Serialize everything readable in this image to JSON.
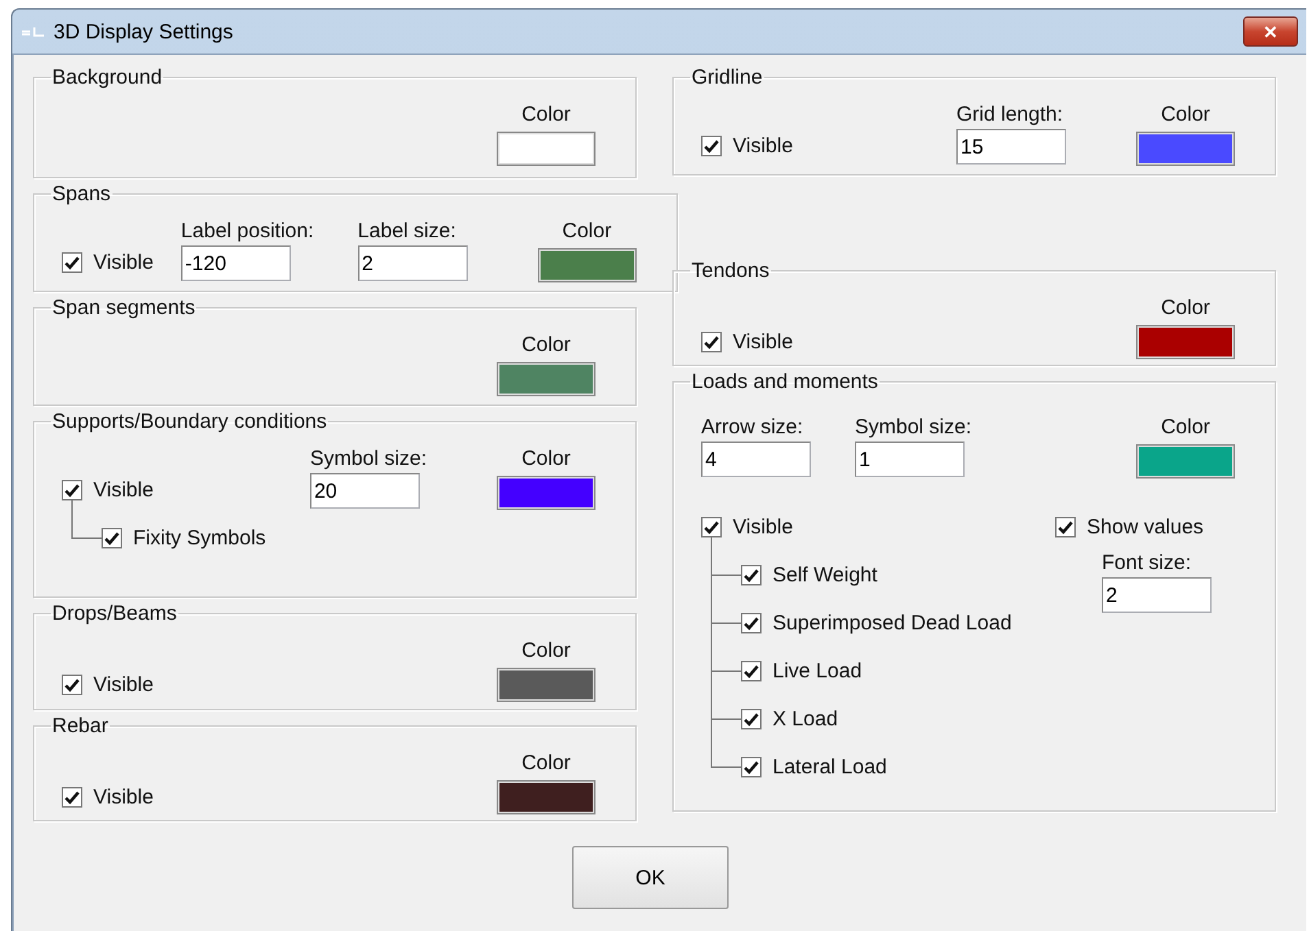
{
  "window": {
    "title": "3D Display Settings",
    "close": "✕"
  },
  "left_groups": [
    {
      "title": "Background",
      "color": {
        "label": "Color",
        "color": "#ffffff"
      }
    },
    {
      "title": "Spans",
      "visible": {
        "label": "Visible",
        "checked": true
      },
      "fields": [
        {
          "label": "Label position:",
          "value": "-120"
        },
        {
          "label": "Label size:",
          "value": "2"
        }
      ],
      "color": {
        "label": "Color",
        "color": "#4b7f4b"
      }
    },
    {
      "title": "Span segments",
      "color": {
        "label": "Color",
        "color": "#4f8462"
      }
    },
    {
      "title": "Supports/Boundary conditions",
      "visible": {
        "label": "Visible",
        "checked": true,
        "children": [
          {
            "label": "Fixity Symbols",
            "checked": true
          }
        ]
      },
      "fields": [
        {
          "label": "Symbol size:",
          "value": "20"
        }
      ],
      "color": {
        "label": "Color",
        "color": "#4400ff"
      }
    },
    {
      "title": "Drops/Beams",
      "visible": {
        "label": "Visible",
        "checked": true
      },
      "color": {
        "label": "Color",
        "color": "#5a5a5a"
      }
    },
    {
      "title": "Rebar",
      "visible": {
        "label": "Visible",
        "checked": true
      },
      "color": {
        "label": "Color",
        "color": "#3f1f1f"
      }
    }
  ],
  "right_groups": [
    {
      "title": "Gridline",
      "visible": {
        "label": "Visible",
        "checked": true
      },
      "fields": [
        {
          "label": "Grid length:",
          "value": "15"
        }
      ],
      "color": {
        "label": "Color",
        "color": "#4a4aff"
      }
    },
    {
      "title": "Tendons",
      "visible": {
        "label": "Visible",
        "checked": true
      },
      "color": {
        "label": "Color",
        "color": "#aa0000"
      }
    },
    {
      "title": "Loads and moments",
      "fields": [
        {
          "label": "Arrow size:",
          "value": "4"
        },
        {
          "label": "Symbol size:",
          "value": "1"
        }
      ],
      "color": {
        "label": "Color",
        "color": "#0aa58a"
      },
      "visible": {
        "label": "Visible",
        "checked": true,
        "children": [
          {
            "label": "Self Weight",
            "checked": true
          },
          {
            "label": "Superimposed Dead Load",
            "checked": true
          },
          {
            "label": "Live Load",
            "checked": true
          },
          {
            "label": "X Load",
            "checked": true
          },
          {
            "label": "Lateral Load",
            "checked": true
          }
        ]
      },
      "show_values": {
        "label": "Show values",
        "checked": true
      },
      "extra_fields": [
        {
          "label": "Font size:",
          "value": "2"
        }
      ]
    }
  ],
  "ok_button": "OK"
}
